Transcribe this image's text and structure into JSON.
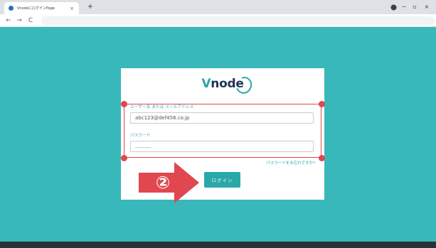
{
  "browser": {
    "tab_title": "VnodeにログインPage",
    "tab_close": "×",
    "new_tab": "+",
    "minimize": "−",
    "restore": "▫",
    "close": "×",
    "back": "←",
    "forward": "→",
    "reload": "C"
  },
  "login": {
    "logo_prefix": "V",
    "logo_rest": "node",
    "username_label": "ユーザー名 または メールアドレス",
    "username_value": "abc123@def456.co.jp",
    "password_label": "パスワード",
    "password_value": "..........",
    "forgot_link": "パスワードをお忘れですか?",
    "login_button": "ログイン"
  },
  "annotation": {
    "step_number": "②",
    "accent_color": "#e0474f"
  },
  "colors": {
    "background": "#38b8ba",
    "brand": "#2aa7a9"
  }
}
